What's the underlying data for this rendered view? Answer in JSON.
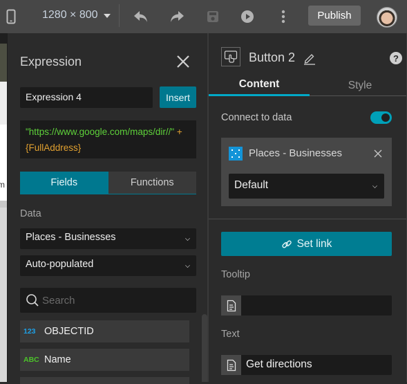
{
  "toolbar": {
    "device_icon": "mobile-device-icon",
    "resolution": "1280 × 800",
    "undo_icon": "undo-icon",
    "redo_icon": "redo-icon",
    "save_icon": "save-icon",
    "preview_icon": "play-icon",
    "more_icon": "more-vertical-icon",
    "publish_label": "Publish",
    "avatar": "user-avatar"
  },
  "canvas_strip": {
    "partial_text": "m"
  },
  "expression_panel": {
    "title": "Expression",
    "name_value": "Expression 4",
    "insert_label": "Insert",
    "expression_string": "\"https://www.google.com/maps/dir//\"",
    "expression_operator": " + ",
    "expression_field": "{FullAddress}",
    "tabs": [
      {
        "label": "Fields",
        "active": true
      },
      {
        "label": "Functions",
        "active": false
      }
    ],
    "data_label": "Data",
    "data_source": "Places - Businesses",
    "population_mode": "Auto-populated",
    "search_placeholder": "Search",
    "fields": [
      {
        "type": "123",
        "type_color": "#1ea0e6",
        "name": "OBJECTID"
      },
      {
        "type": "ABC",
        "type_color": "#4cc32a",
        "name": "Name"
      }
    ]
  },
  "settings_panel": {
    "widget_name": "Button 2",
    "tabs": [
      {
        "label": "Content",
        "active": true
      },
      {
        "label": "Style",
        "active": false
      }
    ],
    "connect_label": "Connect to data",
    "connect_enabled": true,
    "data_source": {
      "name": "Places - Businesses",
      "view": "Default"
    },
    "set_link_label": "Set link",
    "tooltip_label": "Tooltip",
    "tooltip_value": "",
    "text_label": "Text",
    "text_value": "Get directions"
  },
  "colors": {
    "accent": "#00788f",
    "toggle_on": "#00a0b8",
    "code_string": "#5ed13a",
    "code_operator": "#e0a030",
    "tab_indicator": "#00a9c7"
  }
}
